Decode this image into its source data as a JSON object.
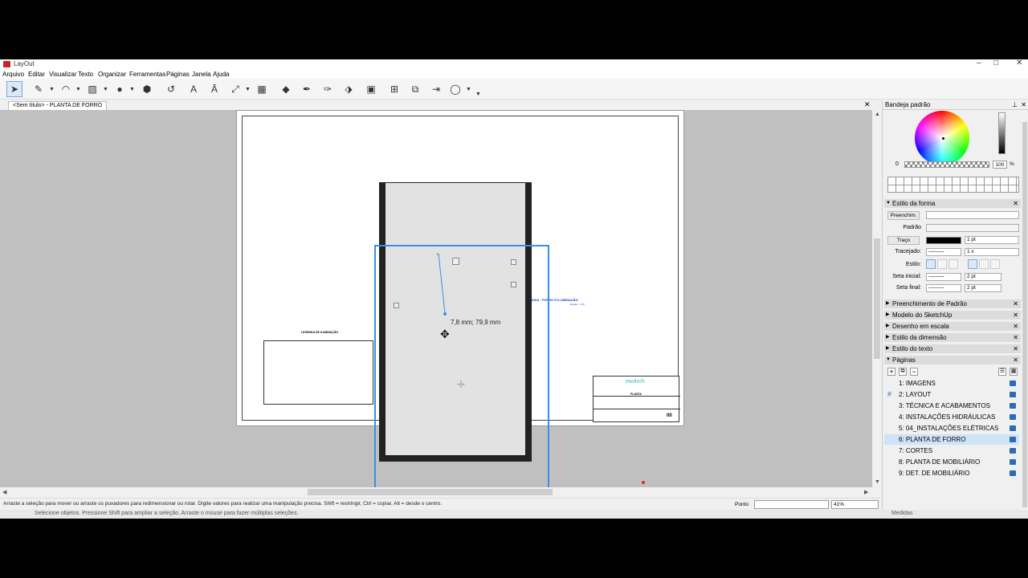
{
  "app": {
    "title": "LayOut"
  },
  "menu": [
    "Arquivo",
    "Editar",
    "Visualizar",
    "Texto",
    "Organizar",
    "Ferramentas",
    "Páginas",
    "Janela",
    "Ajuda"
  ],
  "document_tab": "<Sem título> - PLANTA DE FORRO",
  "canvas": {
    "legend_title": "LEGENDA DE ILUMINAÇÃO",
    "blue_title": "BAIXA - FORRO E ILUMINAÇÃO",
    "blue_sub": "Escala - 1:30",
    "dimension_label": "7,8 mm; 79,9 mm",
    "stamp": {
      "logo": "ewArch",
      "tag": "PLANTA",
      "num": "00"
    }
  },
  "statusbar": {
    "message": "Arraste a seleção para mover ou arraste os puxadores para redimensionar ou rotar. Digite valores para realizar uma manipulação precisa. Shift = restringir, Ctrl = copiar, Alt = desde o centro.",
    "point_label": "Ponto",
    "zoom": "41%"
  },
  "behind_text": "Selecione objetos. Pressione Shift para ampliar a seleção. Arraste o mouse para fazer múltiplas seleções.",
  "behind_right": "Medidas",
  "tray": {
    "title": "Bandeja padrão",
    "alpha_min": "0",
    "alpha_value": "100",
    "alpha_unit": "%",
    "shape_style": {
      "title": "Estilo da forma",
      "fill_label": "Preenchim.",
      "pattern_label": "Padrão",
      "stroke_label": "Traço",
      "stroke_width": "1 pt",
      "dash_label": "Tracejado:",
      "dash_scale": "1 x",
      "style_label": "Estilo:",
      "start_arrow_label": "Seta inicial:",
      "start_arrow_size": "2 pt",
      "end_arrow_label": "Seta final:",
      "end_arrow_size": "2 pt"
    },
    "sections": [
      "Preenchimento de Padrão",
      "Modelo do SketchUp",
      "Desenho em escala",
      "Estilo da dimensão",
      "Estilo do texto"
    ],
    "pages_title": "Páginas",
    "pages": [
      "1: IMAGENS",
      "2: LAYOUT",
      "3: TÉCNICA E ACABAMENTOS",
      "4: INSTALAÇÕES HIDRÁULICAS",
      "5: 04_INSTALAÇÕES ELÉTRICAS",
      "6: PLANTA DE FORRO",
      "7: CORTES",
      "8: PLANTA DE MOBILIÁRIO",
      "9: DET. DE MOBILIÁRIO"
    ],
    "selected_page": 5
  },
  "colors": {
    "selection": "#3a8ee6",
    "accent": "#2a6cb5",
    "canvas_bg": "#c0c0c0"
  }
}
